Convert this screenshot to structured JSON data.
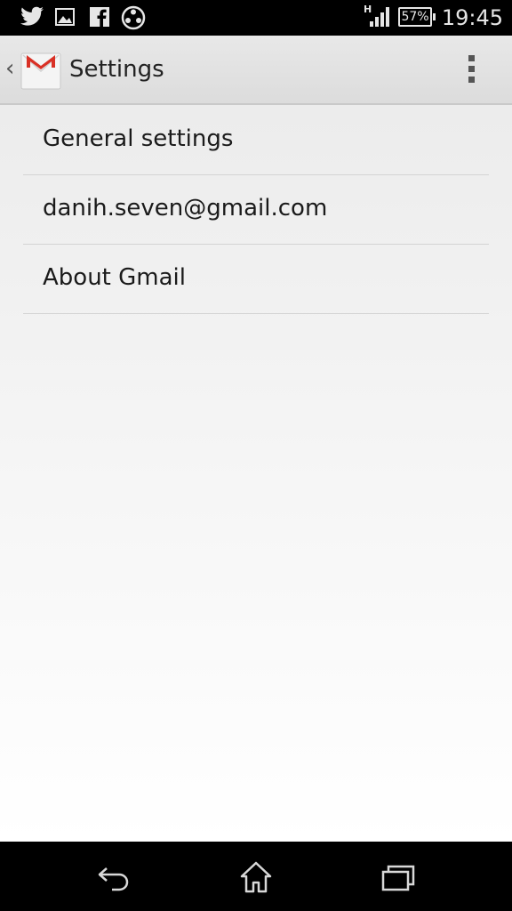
{
  "status_bar": {
    "icons": [
      "twitter-icon",
      "gallery-icon",
      "facebook-icon",
      "movie-reel-icon"
    ],
    "network_type": "H",
    "battery_percent": "57%",
    "battery_level": 57,
    "time": "19:45"
  },
  "action_bar": {
    "title": "Settings",
    "app_icon": "gmail-icon",
    "overflow_icon": "overflow-menu-icon"
  },
  "settings_list": {
    "items": [
      {
        "label": "General settings"
      },
      {
        "label": "danih.seven@gmail.com"
      },
      {
        "label": "About Gmail"
      }
    ]
  },
  "nav_bar": {
    "back_icon": "back-icon",
    "home_icon": "home-icon",
    "recents_icon": "recent-apps-icon"
  },
  "colors": {
    "status_bar_bg": "#000000",
    "action_bar_bg": "#e2e2e2",
    "gmail_red": "#d93025",
    "text": "#1a1a1a"
  }
}
